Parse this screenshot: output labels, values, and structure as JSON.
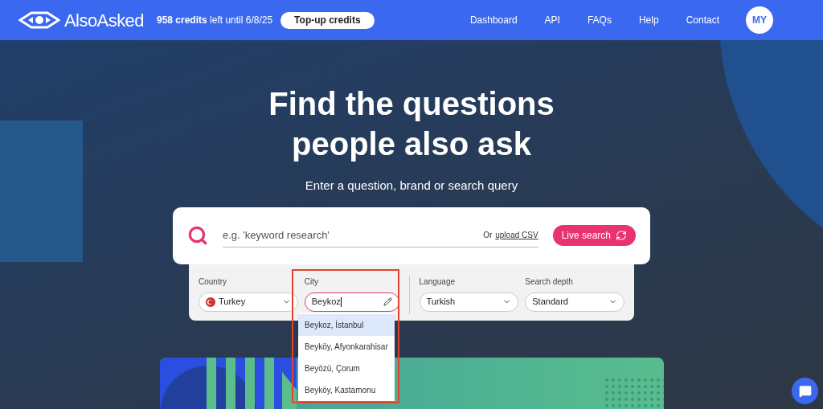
{
  "header": {
    "logo": "AlsoAsked",
    "credits": "**958 credits** left until 6/8/25",
    "topup_button": "Top-up credits",
    "nav": [
      "Dashboard",
      "API",
      "FAQs",
      "Help",
      "Contact"
    ],
    "avatar": "MY"
  },
  "hero": {
    "title_lines": [
      "Find the questions",
      "people also ask"
    ],
    "subtitle": "Enter a question, brand or search query"
  },
  "search": {
    "placeholder": "e.g. 'keyword research'",
    "upload_prefix": "Or",
    "upload_link": "upload CSV",
    "button": "Live search"
  },
  "options": [
    {
      "kind": "select",
      "label": "Country",
      "value": "Turkey",
      "flag": true
    },
    {
      "kind": "input",
      "label": "City",
      "value": "Beykoz",
      "focused": true
    },
    {
      "kind": "select",
      "label": "Language",
      "value": "Turkish",
      "flag": false
    },
    {
      "kind": "select",
      "label": "Search depth",
      "value": "Standard",
      "flag": false
    }
  ],
  "city_suggestions": [
    {
      "label": "Beykoz, İstanbul",
      "selected": true
    },
    {
      "label": "Beyköy, Afyonkarahisar",
      "selected": false
    },
    {
      "label": "Beyözü, Çorum",
      "selected": false
    },
    {
      "label": "Beyköy, Kastamonu",
      "selected": false
    }
  ]
}
